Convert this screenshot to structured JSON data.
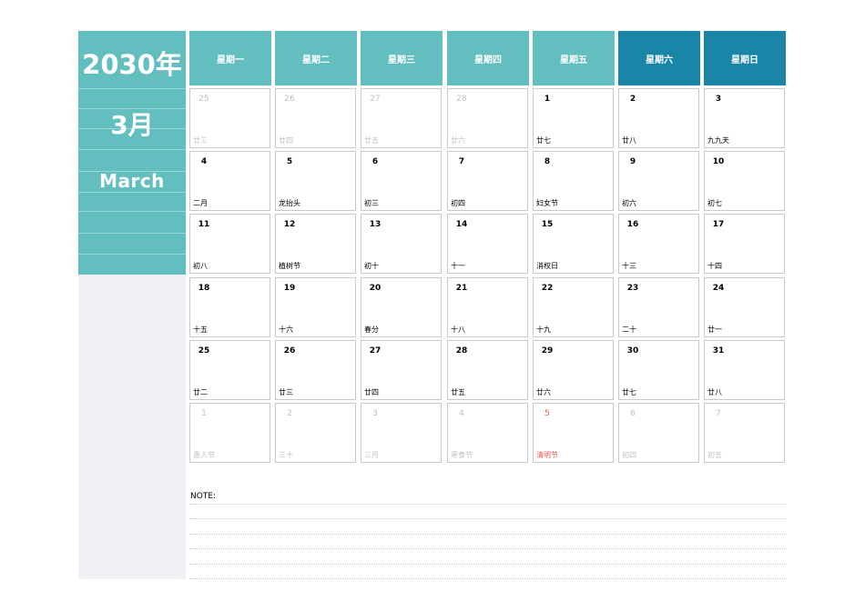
{
  "sidebar": {
    "year": "2030年",
    "month_cn": "3月",
    "month_en": "March"
  },
  "weekdays": [
    "星期一",
    "星期二",
    "星期三",
    "星期四",
    "星期五",
    "星期六",
    "星期日"
  ],
  "weeks": [
    [
      {
        "day": "25",
        "lunar": "廿三",
        "state": "other"
      },
      {
        "day": "26",
        "lunar": "廿四",
        "state": "other"
      },
      {
        "day": "27",
        "lunar": "廿五",
        "state": "other"
      },
      {
        "day": "28",
        "lunar": "廿六",
        "state": "other"
      },
      {
        "day": "1",
        "lunar": "廿七",
        "state": ""
      },
      {
        "day": "2",
        "lunar": "廿八",
        "state": ""
      },
      {
        "day": "3",
        "lunar": "九九天",
        "state": ""
      }
    ],
    [
      {
        "day": "4",
        "lunar": "二月",
        "state": ""
      },
      {
        "day": "5",
        "lunar": "龙抬头",
        "state": ""
      },
      {
        "day": "6",
        "lunar": "初三",
        "state": ""
      },
      {
        "day": "7",
        "lunar": "初四",
        "state": ""
      },
      {
        "day": "8",
        "lunar": "妇女节",
        "state": ""
      },
      {
        "day": "9",
        "lunar": "初六",
        "state": ""
      },
      {
        "day": "10",
        "lunar": "初七",
        "state": ""
      }
    ],
    [
      {
        "day": "11",
        "lunar": "初八",
        "state": ""
      },
      {
        "day": "12",
        "lunar": "植树节",
        "state": ""
      },
      {
        "day": "13",
        "lunar": "初十",
        "state": ""
      },
      {
        "day": "14",
        "lunar": "十一",
        "state": ""
      },
      {
        "day": "15",
        "lunar": "消权日",
        "state": ""
      },
      {
        "day": "16",
        "lunar": "十三",
        "state": ""
      },
      {
        "day": "17",
        "lunar": "十四",
        "state": ""
      }
    ],
    [
      {
        "day": "18",
        "lunar": "十五",
        "state": ""
      },
      {
        "day": "19",
        "lunar": "十六",
        "state": ""
      },
      {
        "day": "20",
        "lunar": "春分",
        "state": ""
      },
      {
        "day": "21",
        "lunar": "十八",
        "state": ""
      },
      {
        "day": "22",
        "lunar": "十九",
        "state": ""
      },
      {
        "day": "23",
        "lunar": "二十",
        "state": ""
      },
      {
        "day": "24",
        "lunar": "廿一",
        "state": ""
      }
    ],
    [
      {
        "day": "25",
        "lunar": "廿二",
        "state": ""
      },
      {
        "day": "26",
        "lunar": "廿三",
        "state": ""
      },
      {
        "day": "27",
        "lunar": "廿四",
        "state": ""
      },
      {
        "day": "28",
        "lunar": "廿五",
        "state": ""
      },
      {
        "day": "29",
        "lunar": "廿六",
        "state": ""
      },
      {
        "day": "30",
        "lunar": "廿七",
        "state": ""
      },
      {
        "day": "31",
        "lunar": "廿八",
        "state": ""
      }
    ],
    [
      {
        "day": "1",
        "lunar": "愚人节",
        "state": "other"
      },
      {
        "day": "2",
        "lunar": "三十",
        "state": "other"
      },
      {
        "day": "3",
        "lunar": "三月",
        "state": "other"
      },
      {
        "day": "4",
        "lunar": "寒食节",
        "state": "other"
      },
      {
        "day": "5",
        "lunar": "清明节",
        "state": "holiday"
      },
      {
        "day": "6",
        "lunar": "初四",
        "state": "other"
      },
      {
        "day": "7",
        "lunar": "初五",
        "state": "other"
      }
    ]
  ],
  "note": {
    "label": "NOTE:"
  },
  "colors": {
    "teal": "#63bfbf",
    "weekend_blue": "#1a85a6",
    "sidebar_gray": "#f0f0f5",
    "holiday_red": "#ec5a5a",
    "muted": "#c0c0c0"
  }
}
